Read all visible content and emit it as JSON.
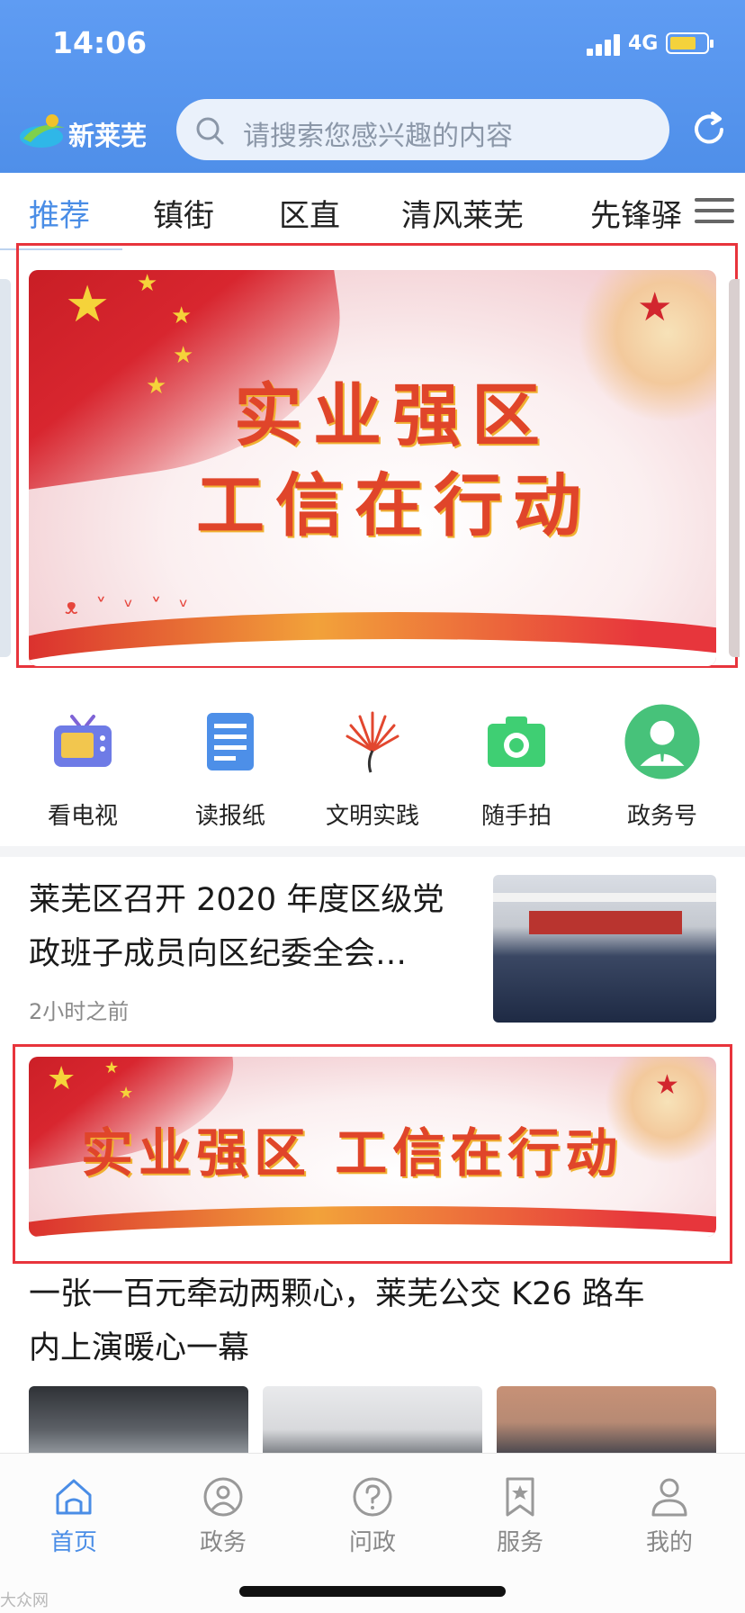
{
  "status": {
    "time": "14:06",
    "network": "4G"
  },
  "header": {
    "app_name": "新莱芜",
    "search_placeholder": "请搜索您感兴趣的内容"
  },
  "tabs": [
    {
      "label": "推荐",
      "active": true
    },
    {
      "label": "镇街",
      "active": false
    },
    {
      "label": "区直",
      "active": false
    },
    {
      "label": "清风莱芜",
      "active": false
    },
    {
      "label": "先锋驿",
      "active": false
    }
  ],
  "banner_main": {
    "line1": "实业强区",
    "line2": "工信在行动"
  },
  "quick_links": [
    {
      "label": "看电视",
      "icon": "tv-icon"
    },
    {
      "label": "读报纸",
      "icon": "newspaper-icon"
    },
    {
      "label": "文明实践",
      "icon": "fan-emblem-icon"
    },
    {
      "label": "随手拍",
      "icon": "camera-icon"
    },
    {
      "label": "政务号",
      "icon": "official-account-icon"
    }
  ],
  "news": [
    {
      "title_line1": "莱芜区召开 2020 年度区级党",
      "title_line2": "政班子成员向区纪委全会…",
      "time": "2小时之前"
    },
    {
      "title_line1": "一张一百元牵动两颗心，莱芜公交 K26 路车",
      "title_line2": "内上演暖心一幕"
    }
  ],
  "banner_small": {
    "text": "实业强区  工信在行动"
  },
  "bottom_nav": [
    {
      "label": "首页",
      "icon": "home-icon",
      "active": true
    },
    {
      "label": "政务",
      "icon": "person-badge-icon",
      "active": false
    },
    {
      "label": "问政",
      "icon": "question-icon",
      "active": false
    },
    {
      "label": "服务",
      "icon": "bookmark-star-icon",
      "active": false
    },
    {
      "label": "我的",
      "icon": "user-icon",
      "active": false
    }
  ],
  "watermark": "大众网",
  "colors": {
    "accent": "#4a8de6",
    "header": "#5593ee",
    "highlight_box": "#e8343c"
  }
}
